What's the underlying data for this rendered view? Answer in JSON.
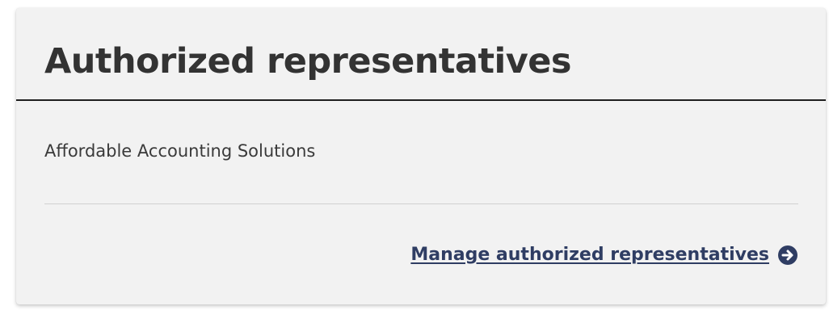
{
  "card": {
    "title": "Authorized representatives",
    "representative_name": "Affordable Accounting Solutions",
    "manage_link_label": "Manage authorized representatives",
    "manage_link_icon": "arrow-circle-right-icon"
  },
  "colors": {
    "card_background": "#f2f2f2",
    "title_text": "#333333",
    "link_text": "#2f3d63",
    "header_rule": "#1f1f1f"
  }
}
